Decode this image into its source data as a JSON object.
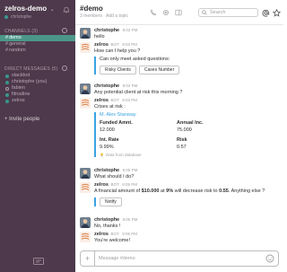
{
  "team": {
    "name": "zelros-demo",
    "user": "christophe"
  },
  "channels": {
    "title": "CHANNELS (3)",
    "items": [
      {
        "label": "demo",
        "active": true
      },
      {
        "label": "general",
        "active": false
      },
      {
        "label": "random",
        "active": false
      }
    ]
  },
  "dms": {
    "title": "DIRECT MESSAGES (5)",
    "items": [
      {
        "label": "slackbot"
      },
      {
        "label": "christophe (you)"
      },
      {
        "label": "fabien"
      },
      {
        "label": "fitnsdine"
      },
      {
        "label": "zelros"
      }
    ],
    "invite": "+ Invite people"
  },
  "header": {
    "title": "#demo",
    "members": "3 members",
    "pinned": "Add a topic",
    "search_placeholder": "Search"
  },
  "messages": [
    {
      "author": "christophe",
      "ts": "9:03 PM",
      "text": "hello"
    },
    {
      "author": "zelros",
      "tag": "BOT",
      "ts": "9:03 PM",
      "text": "How can I help you ?",
      "attachment": "Can only meet asked questions:",
      "buttons": [
        "Risky Clients",
        "Cases Number"
      ]
    },
    {
      "author": "christophe",
      "ts": "9:03 PM",
      "text": "Any potential client at risk this morning ?"
    },
    {
      "author": "zelros",
      "tag": "BOT",
      "ts": "9:03 PM",
      "text": "Crises at risk :",
      "card": {
        "title": "M. Alex Stanway",
        "fields": [
          {
            "label": "Funded Amnt.",
            "value": "12.000"
          },
          {
            "label": "Annual Inc.",
            "value": "75.000"
          },
          {
            "label": "Int. Rate",
            "value": "9.99%"
          },
          {
            "label": "Risk",
            "value": "0.57"
          }
        ],
        "footer": "Data from database"
      }
    },
    {
      "author": "christophe",
      "ts": "9:05 PM",
      "text": "What should I do?"
    },
    {
      "author": "zelros",
      "tag": "BOT",
      "ts": "9:05 PM",
      "text_pre": "A financial amount of ",
      "amount": "$10.000",
      "text_mid": " at ",
      "rate": "9%",
      "text_mid2": " will decrease risk to ",
      "risk": "0.55",
      "text_post": ". Anything else ?",
      "button": "Notify"
    },
    {
      "author": "christophe",
      "ts": "9:05 PM",
      "text": "No, thanks !"
    },
    {
      "author": "zelros",
      "tag": "BOT",
      "ts": "9:05 PM",
      "text": "You're welcome!"
    }
  ],
  "composer": {
    "placeholder": "Message #demo"
  }
}
